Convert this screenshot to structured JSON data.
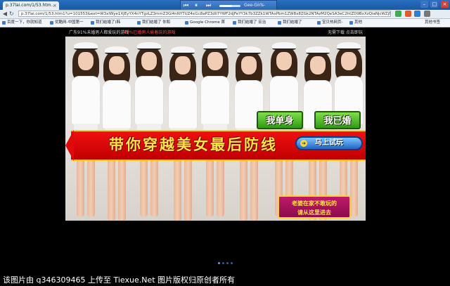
{
  "browser": {
    "tab": {
      "title": "p.37lai.com/1/53.htm..."
    },
    "url": "p.37lai.com/1/53.htm1?u=101553&ext=W3xlWye1XjEyYX4nYTgzLZ3mmZ3Gi4nNYTUZ4sI1c8aPZ3dlI7YWF2dJFeYY3k7b3ZZk1WTAxPbm1ZW8x8ZGk2NTAzM2QeSA3eC2htZD9BxXzQiaNjcWZjNA0YmTlwWyYfeWUmNGZ0Y8NSMTAxTUc&ext=W3TlWyYG1LZnWVX5Ogimt2NjIxQjZmY",
    "media_player": {
      "title": "Gee-Girls-BigBang",
      "volume": 0.6
    },
    "window_buttons": {
      "minimize": "–",
      "maximize": "□",
      "close": "×"
    },
    "bookmarks": [
      "百度一下，你就知道",
      "优酷网-中国第一",
      "我们结婚了(韩",
      "我们结婚了 你和",
      "Google Chrome 首",
      "我们结婚了 宏治",
      "我们结婚了",
      "宝贝热网页-",
      "其他"
    ],
    "bookmarks_extra": "其他书签"
  },
  "page": {
    "promo_left": "广东91%未婚男人都爱玩的游戏",
    "promo_right": "43%已婚男人偷着玩的游戏",
    "top_right_links": "无需下载  点击即玩"
  },
  "banner": {
    "slogan": "带你穿越美女最后防线",
    "btn_single": "我单身",
    "btn_married": "我已婚",
    "start_button": "马上试玩",
    "start_arrow": "➜",
    "notice": "老婆在家不敢玩的\n请从这里进去"
  },
  "pager": {
    "count": 4,
    "active": 0
  },
  "watermark": "该图片由 q346309465 上传至 Tiexue.Net 图片版权归原创者所有",
  "colors": {
    "accent_red": "#e00a0a",
    "slogan_yellow": "#ffe14a",
    "button_green": "#2f9a14",
    "button_blue": "#1d66c7",
    "notice_magenta": "#8a0c4a"
  }
}
